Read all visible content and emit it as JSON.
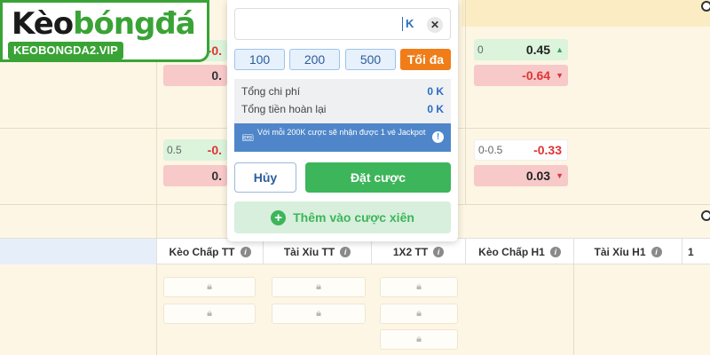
{
  "logo": {
    "brand_part1": "Kèo",
    "brand_part2": "bóngđá",
    "site": "KEOBONGDA2.VIP"
  },
  "betslip": {
    "stake_value": "",
    "k_suffix": "K",
    "clear_symbol": "✕",
    "quick_amounts": [
      "100",
      "200",
      "500"
    ],
    "max_label": "Tối đa",
    "total_cost_label": "Tổng chi phí",
    "total_cost_value": "0 K",
    "total_refund_label": "Tổng tiền hoàn lại",
    "total_refund_value": "0 K",
    "promo_text": "Với mỗi 200K cược sẽ nhận được 1 vé Jackpot",
    "cancel_label": "Hủy",
    "place_label": "Đặt cược",
    "parlay_label": "Thêm vào cược xiên"
  },
  "odds": {
    "row1_left_top": "-0.",
    "row1_left_bottom": "0.",
    "row1_right_hc": "0",
    "row1_right_top": "0.45",
    "row1_right_bottom": "-0.64",
    "row2_left_hc": "0.5",
    "row2_left_top": "-0.",
    "row2_left_bottom": "0.",
    "row2_right_hc": "0-0.5",
    "row2_right_top": "-0.33",
    "row2_right_bottom": "0.03"
  },
  "columns": {
    "h1": "Kèo Chấp TT",
    "h2": "Tài Xỉu TT",
    "h3": "1X2 TT",
    "h4": "Kèo Chấp H1",
    "h5": "Tài Xỉu H1",
    "h6": "1",
    "info_symbol": "i"
  },
  "colors": {
    "accent_green": "#3db55a",
    "accent_orange": "#f07d18",
    "accent_blue": "#4f86c9",
    "brand_green": "#3aa336"
  }
}
